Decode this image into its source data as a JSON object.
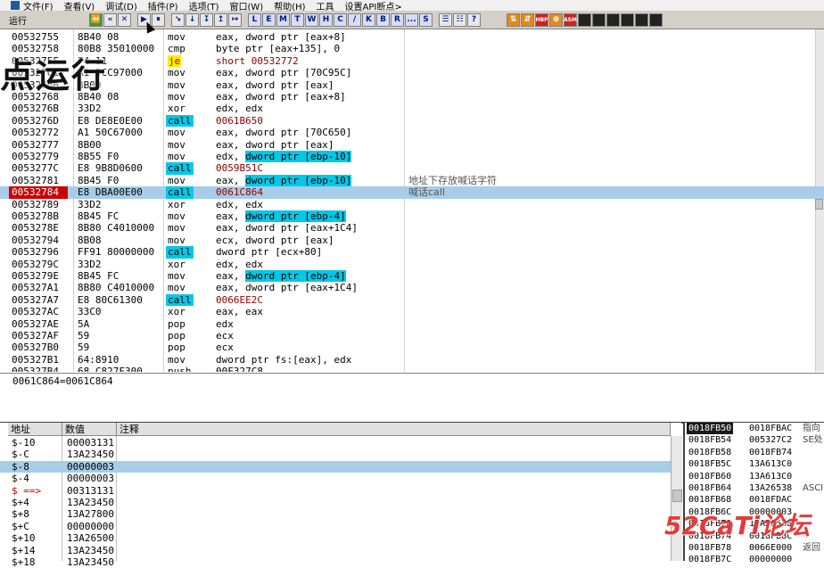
{
  "menu": {
    "items": [
      "文件(F)",
      "查看(V)",
      "调试(D)",
      "插件(P)",
      "选项(T)",
      "窗口(W)",
      "帮助(H)",
      "工具",
      "设置API断点>"
    ]
  },
  "toolbar": {
    "status": "运行",
    "buttons_a": [
      "⏪",
      "«",
      "✕",
      "▶",
      "⏸",
      "↘",
      "↓",
      "↧",
      "↥",
      "↦"
    ],
    "letters": [
      "L",
      "E",
      "M",
      "T",
      "W",
      "H",
      "C",
      "/",
      "K",
      "B",
      "R",
      "...",
      "S"
    ],
    "buttons_b": [
      "☰",
      "☷",
      "?"
    ],
    "buttons_c": [
      "⇅",
      "⇵",
      "HBP",
      "⊕",
      "ASM"
    ]
  },
  "overlay_text": "点运行",
  "disasm": [
    {
      "addr": "00532755",
      "hex": "8B40 08",
      "mn": "mov",
      "ops": "eax, dword ptr [eax+8]"
    },
    {
      "addr": "00532758",
      "hex": "80B8 35010000",
      "mn": "cmp",
      "ops": "byte ptr [eax+135], 0"
    },
    {
      "addr": "0053275F",
      "hex": "74 11",
      "mn": "je",
      "ops": "short 00532772",
      "type": "je",
      "tgt": "00532772"
    },
    {
      "addr": "00532761",
      "hex": "A1 5CC97000",
      "mn": "mov",
      "ops": "eax, dword ptr [70C95C]"
    },
    {
      "addr": "00532766",
      "hex": "8B00",
      "mn": "mov",
      "ops": "eax, dword ptr [eax]"
    },
    {
      "addr": "00532768",
      "hex": "8B40 08",
      "mn": "mov",
      "ops": "eax, dword ptr [eax+8]"
    },
    {
      "addr": "0053276B",
      "hex": "33D2",
      "mn": "xor",
      "ops": "edx, edx"
    },
    {
      "addr": "0053276D",
      "hex": "E8 DE8E0E00",
      "mn": "call",
      "ops": "0061B650",
      "type": "call",
      "tgt": "0061B650"
    },
    {
      "addr": "00532772",
      "hex": "A1 50C67000",
      "mn": "mov",
      "ops": "eax, dword ptr [70C650]"
    },
    {
      "addr": "00532777",
      "hex": "8B00",
      "mn": "mov",
      "ops": "eax, dword ptr [eax]"
    },
    {
      "addr": "00532779",
      "hex": "8B55 F0",
      "mn": "mov",
      "ops_pre": "edx, ",
      "hl": "dword ptr [ebp-10]"
    },
    {
      "addr": "0053277C",
      "hex": "E8 9B8D0600",
      "mn": "call",
      "ops": "0059B51C",
      "type": "call",
      "tgt": "0059B51C"
    },
    {
      "addr": "00532781",
      "hex": "8B45 F0",
      "mn": "mov",
      "ops_pre": "eax, ",
      "hl": "dword ptr [ebp-10]",
      "comment": "地址下存放喊话字符"
    },
    {
      "addr": "00532784",
      "hex": "E8 DBA00E00",
      "mn": "call",
      "ops": "0061C864",
      "type": "call",
      "tgt": "0061C864",
      "sel": true,
      "hot": true,
      "comment": "喊话call"
    },
    {
      "addr": "00532789",
      "hex": "33D2",
      "mn": "xor",
      "ops": "edx, edx"
    },
    {
      "addr": "0053278B",
      "hex": "8B45 FC",
      "mn": "mov",
      "ops_pre": "eax, ",
      "hl": "dword ptr [ebp-4]"
    },
    {
      "addr": "0053278E",
      "hex": "8B80 C4010000",
      "mn": "mov",
      "ops": "eax, dword ptr [eax+1C4]"
    },
    {
      "addr": "00532794",
      "hex": "8B08",
      "mn": "mov",
      "ops": "ecx, dword ptr [eax]"
    },
    {
      "addr": "00532796",
      "hex": "FF91 80000000",
      "mn": "call",
      "ops": "dword ptr [ecx+80]",
      "type": "call"
    },
    {
      "addr": "0053279C",
      "hex": "33D2",
      "mn": "xor",
      "ops": "edx, edx"
    },
    {
      "addr": "0053279E",
      "hex": "8B45 FC",
      "mn": "mov",
      "ops_pre": "eax, ",
      "hl": "dword ptr [ebp-4]"
    },
    {
      "addr": "005327A1",
      "hex": "8B80 C4010000",
      "mn": "mov",
      "ops": "eax, dword ptr [eax+1C4]"
    },
    {
      "addr": "005327A7",
      "hex": "E8 80C61300",
      "mn": "call",
      "ops": "0066EE2C",
      "type": "call",
      "tgt": "0066EE2C"
    },
    {
      "addr": "005327AC",
      "hex": "33C0",
      "mn": "xor",
      "ops": "eax, eax"
    },
    {
      "addr": "005327AE",
      "hex": "5A",
      "mn": "pop",
      "ops": "edx"
    },
    {
      "addr": "005327AF",
      "hex": "59",
      "mn": "pop",
      "ops": "ecx"
    },
    {
      "addr": "005327B0",
      "hex": "59",
      "mn": "pop",
      "ops": "ecx"
    },
    {
      "addr": "005327B1",
      "hex": "64:8910",
      "mn": "mov",
      "ops": "dword ptr fs:[eax], edx"
    },
    {
      "addr": "005327B4",
      "hex": "68 C827F300",
      "mn": "push",
      "ops": "00F327C8"
    }
  ],
  "info_line": "0061C864=0061C864",
  "stack": {
    "headers": [
      "地址",
      "数值",
      "注释"
    ],
    "rows": [
      {
        "a": "$-10",
        "v": "00003131"
      },
      {
        "a": "$-C",
        "v": "13A23450"
      },
      {
        "a": "$-8",
        "v": "00000003",
        "sel": true
      },
      {
        "a": "$-4",
        "v": "00000003"
      },
      {
        "a": "$ ==>",
        "v": "00313131",
        "red": true
      },
      {
        "a": "$+4",
        "v": "13A23450"
      },
      {
        "a": "$+8",
        "v": "13A27800"
      },
      {
        "a": "$+C",
        "v": "00000000"
      },
      {
        "a": "$+10",
        "v": "13A26500"
      },
      {
        "a": "$+14",
        "v": "13A23450"
      },
      {
        "a": "$+18",
        "v": "13A23450"
      }
    ]
  },
  "memory": [
    {
      "a": "0018FB50",
      "v": "0018FBAC",
      "c": "指向",
      "cur": true
    },
    {
      "a": "0018FB54",
      "v": "005327C2",
      "c": "SE处"
    },
    {
      "a": "0018FB58",
      "v": "0018FB74",
      "c": ""
    },
    {
      "a": "0018FB5C",
      "v": "13A613C0",
      "c": ""
    },
    {
      "a": "0018FB60",
      "v": "13A613C0",
      "c": ""
    },
    {
      "a": "0018FB64",
      "v": "13A26538",
      "c": "ASCI"
    },
    {
      "a": "0018FB68",
      "v": "0018FDAC",
      "c": ""
    },
    {
      "a": "0018FB6C",
      "v": "00000003",
      "c": ""
    },
    {
      "a": "0018FB70",
      "v": "13A26538",
      "c": ""
    },
    {
      "a": "0018FB74",
      "v": "0018FB8C",
      "c": ""
    },
    {
      "a": "0018FB78",
      "v": "0066E000",
      "c": "返回"
    },
    {
      "a": "0018FB7C",
      "v": "00000000",
      "c": ""
    }
  ],
  "watermark": "52CaTi论坛"
}
